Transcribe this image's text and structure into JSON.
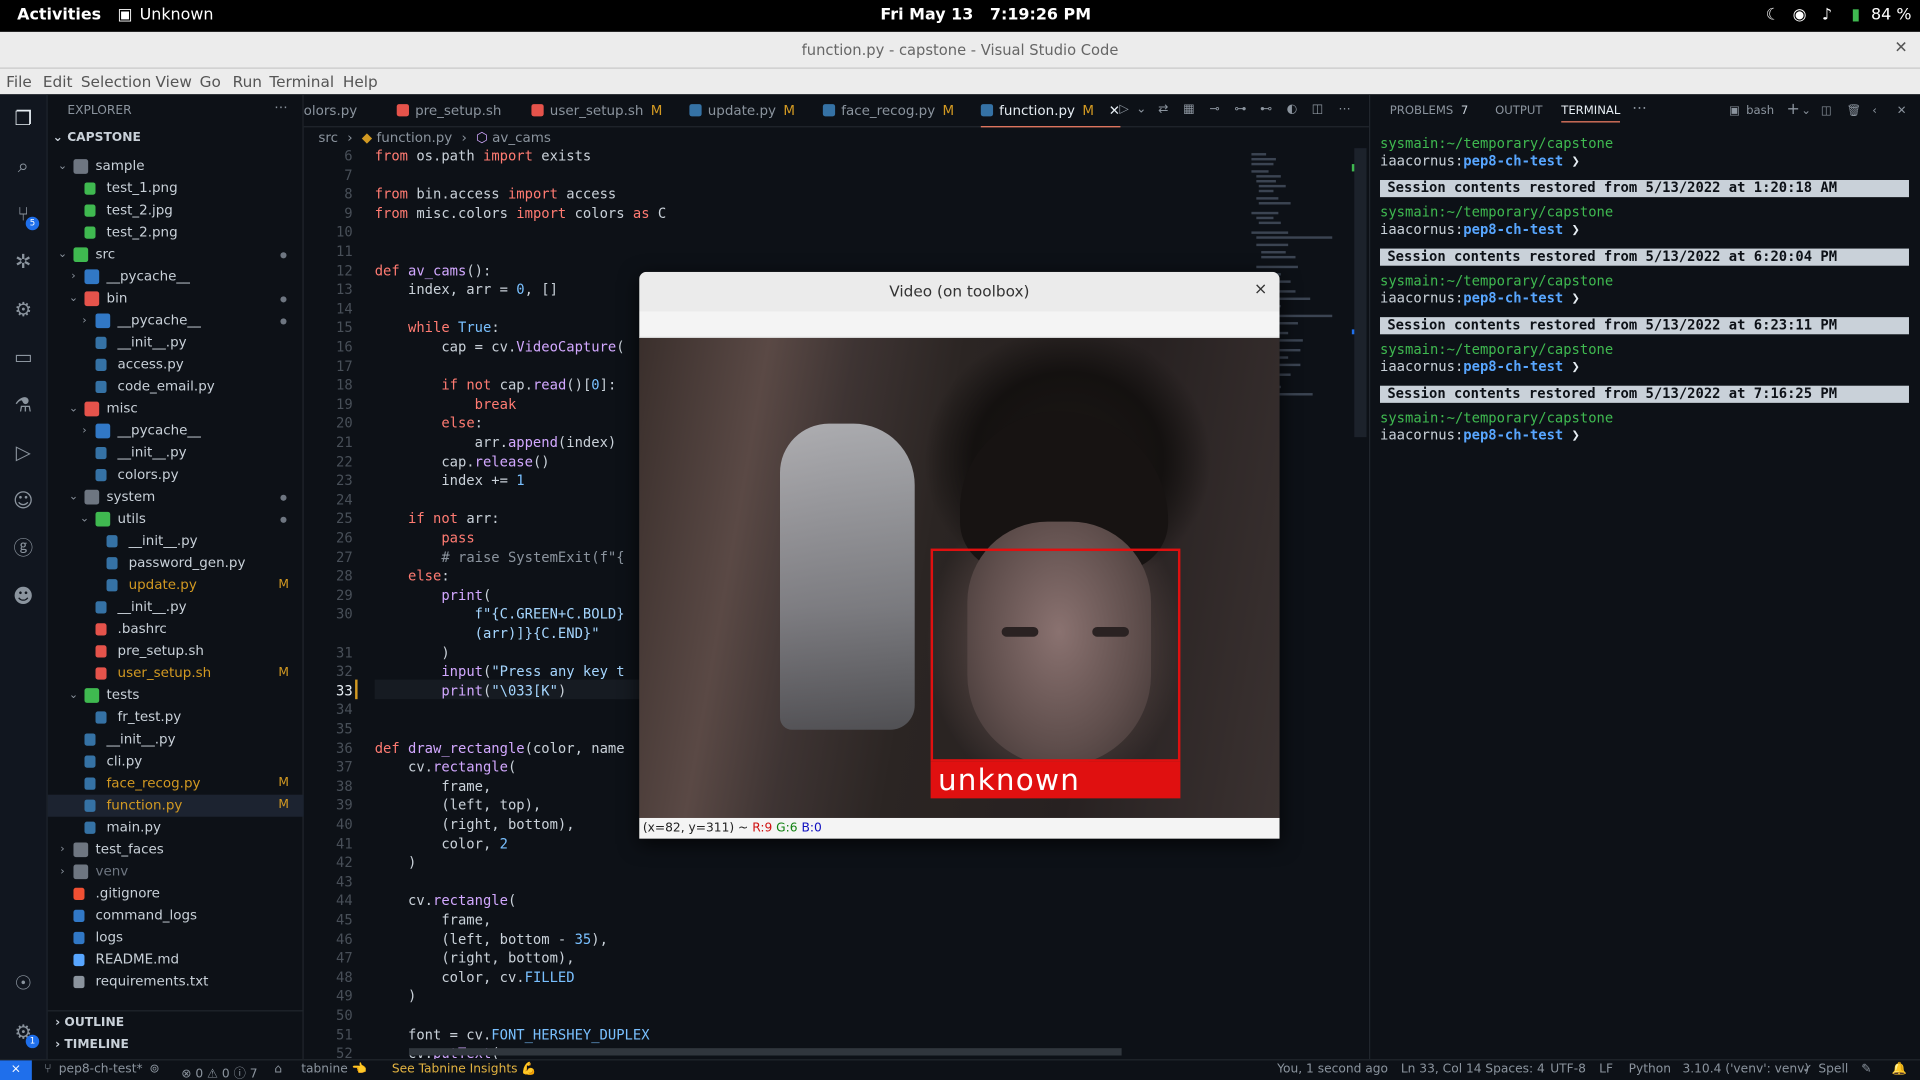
{
  "gnome": {
    "activities": "Activities",
    "app": "Unknown",
    "clock": "Fri May 13   7:19:26 PM",
    "battery": "84 %"
  },
  "window": {
    "title": "function.py - capstone - Visual Studio Code"
  },
  "menu": [
    "File",
    "Edit",
    "Selection",
    "View",
    "Go",
    "Run",
    "Terminal",
    "Help"
  ],
  "activity_badges": {
    "scm": "5",
    "settings": "1"
  },
  "explorer": {
    "header": "EXPLORER",
    "root": "CAPSTONE",
    "items": [
      {
        "l": "sample",
        "d": 1,
        "t": "dir",
        "open": true
      },
      {
        "l": "test_1.png",
        "d": 2,
        "t": "img"
      },
      {
        "l": "test_2.jpg",
        "d": 2,
        "t": "img"
      },
      {
        "l": "test_2.png",
        "d": 2,
        "t": "img"
      },
      {
        "l": "src",
        "d": 1,
        "t": "dir-src",
        "open": true,
        "dot": true
      },
      {
        "l": "__pycache__",
        "d": 2,
        "t": "dir-py",
        "open": false
      },
      {
        "l": "bin",
        "d": 2,
        "t": "dir-red",
        "open": true,
        "dot": true
      },
      {
        "l": "__pycache__",
        "d": 3,
        "t": "dir-py",
        "open": false,
        "dot": true
      },
      {
        "l": "__init__.py",
        "d": 3,
        "t": "py"
      },
      {
        "l": "access.py",
        "d": 3,
        "t": "py"
      },
      {
        "l": "code_email.py",
        "d": 3,
        "t": "py"
      },
      {
        "l": "misc",
        "d": 2,
        "t": "dir-red",
        "open": true
      },
      {
        "l": "__pycache__",
        "d": 3,
        "t": "dir-py",
        "open": false
      },
      {
        "l": "__init__.py",
        "d": 3,
        "t": "py"
      },
      {
        "l": "colors.py",
        "d": 3,
        "t": "py"
      },
      {
        "l": "system",
        "d": 2,
        "t": "dir",
        "open": true,
        "dot": true
      },
      {
        "l": "utils",
        "d": 3,
        "t": "dir-green",
        "open": true,
        "dot": true
      },
      {
        "l": "__init__.py",
        "d": 4,
        "t": "py"
      },
      {
        "l": "password_gen.py",
        "d": 4,
        "t": "py"
      },
      {
        "l": "update.py",
        "d": 4,
        "t": "py",
        "m": "M"
      },
      {
        "l": "__init__.py",
        "d": 3,
        "t": "py"
      },
      {
        "l": ".bashrc",
        "d": 3,
        "t": "sh"
      },
      {
        "l": "pre_setup.sh",
        "d": 3,
        "t": "sh"
      },
      {
        "l": "user_setup.sh",
        "d": 3,
        "t": "sh",
        "m": "M"
      },
      {
        "l": "tests",
        "d": 2,
        "t": "dir-green",
        "open": true
      },
      {
        "l": "fr_test.py",
        "d": 3,
        "t": "py"
      },
      {
        "l": "__init__.py",
        "d": 2,
        "t": "py"
      },
      {
        "l": "cli.py",
        "d": 2,
        "t": "py"
      },
      {
        "l": "face_recog.py",
        "d": 2,
        "t": "py",
        "m": "M"
      },
      {
        "l": "function.py",
        "d": 2,
        "t": "py",
        "m": "M",
        "sel": true
      },
      {
        "l": "main.py",
        "d": 2,
        "t": "py"
      },
      {
        "l": "test_faces",
        "d": 1,
        "t": "dir",
        "open": false
      },
      {
        "l": "venv",
        "d": 1,
        "t": "dir",
        "open": false,
        "dim": true
      },
      {
        "l": ".gitignore",
        "d": 1,
        "t": "git"
      },
      {
        "l": "command_logs",
        "d": 1,
        "t": "file"
      },
      {
        "l": "logs",
        "d": 1,
        "t": "file"
      },
      {
        "l": "README.md",
        "d": 1,
        "t": "info"
      },
      {
        "l": "requirements.txt",
        "d": 1,
        "t": "txt"
      }
    ],
    "outline": "OUTLINE",
    "timeline": "TIMELINE"
  },
  "tabs": [
    {
      "l": "olors.py",
      "m": "",
      "t": "none"
    },
    {
      "l": "pre_setup.sh",
      "m": "",
      "t": "sh"
    },
    {
      "l": "user_setup.sh",
      "m": "M",
      "t": "sh"
    },
    {
      "l": "update.py",
      "m": "M",
      "t": "py"
    },
    {
      "l": "face_recog.py",
      "m": "M",
      "t": "py"
    },
    {
      "l": "function.py",
      "m": "M",
      "t": "py",
      "active": true
    }
  ],
  "breadcrumb": [
    "src",
    "function.py",
    "av_cams"
  ],
  "code": [
    {
      "n": "6",
      "h": "<span class=\"kw\">from</span> os.path <span class=\"kw\">import</span> exists"
    },
    {
      "n": "7",
      "h": ""
    },
    {
      "n": "8",
      "h": "<span class=\"kw\">from</span> bin.access <span class=\"kw\">import</span> access"
    },
    {
      "n": "9",
      "h": "<span class=\"kw\">from</span> misc.colors <span class=\"kw\">import</span> colors <span class=\"kw\">as</span> C"
    },
    {
      "n": "10",
      "h": ""
    },
    {
      "n": "11",
      "h": ""
    },
    {
      "n": "12",
      "h": "<span class=\"kw\">def</span> <span class=\"fn\">av_cams</span>():"
    },
    {
      "n": "13",
      "h": "    index, arr = <span class=\"nu\">0</span>, []"
    },
    {
      "n": "14",
      "h": ""
    },
    {
      "n": "15",
      "h": "    <span class=\"kw\">while</span> <span class=\"nu\">True</span>:"
    },
    {
      "n": "16",
      "h": "        cap = cv.<span class=\"fn\">VideoCapture</span>("
    },
    {
      "n": "17",
      "h": ""
    },
    {
      "n": "18",
      "h": "        <span class=\"kw\">if not</span> cap.<span class=\"fn\">read</span>()[<span class=\"nu\">0</span>]:"
    },
    {
      "n": "19",
      "h": "            <span class=\"kw\">break</span>"
    },
    {
      "n": "20",
      "h": "        <span class=\"kw\">else</span>:"
    },
    {
      "n": "21",
      "h": "            arr.<span class=\"fn\">append</span>(index)"
    },
    {
      "n": "22",
      "h": "        cap.<span class=\"fn\">release</span>()"
    },
    {
      "n": "23",
      "h": "        index += <span class=\"nu\">1</span>"
    },
    {
      "n": "24",
      "h": ""
    },
    {
      "n": "25",
      "h": "    <span class=\"kw\">if not</span> arr:"
    },
    {
      "n": "26",
      "h": "        <span class=\"kw\">pass</span>"
    },
    {
      "n": "27",
      "h": "        <span class=\"cm\"># raise SystemExit(f\"{</span>"
    },
    {
      "n": "28",
      "h": "    <span class=\"kw\">else</span>:"
    },
    {
      "n": "29",
      "h": "        <span class=\"fn\">print</span>("
    },
    {
      "n": "30",
      "h": "            <span class=\"st\">f\"{C.GREEN+C.BOLD}</span>"
    },
    {
      "n": "",
      "h": "            <span class=\"st\">(arr)]}{C.END}\"</span>"
    },
    {
      "n": "31",
      "h": "        )"
    },
    {
      "n": "32",
      "h": "        <span class=\"fn\">input</span>(<span class=\"st\">\"Press any key t</span>"
    },
    {
      "n": "33",
      "h": "        <span class=\"fn\">print</span>(<span class=\"st\">\"\\033[K\"</span>)"
    },
    {
      "n": "34",
      "h": ""
    },
    {
      "n": "35",
      "h": ""
    },
    {
      "n": "36",
      "h": "<span class=\"kw\">def</span> <span class=\"fn\">draw_rectangle</span>(color, name"
    },
    {
      "n": "37",
      "h": "    cv.<span class=\"fn\">rectangle</span>("
    },
    {
      "n": "38",
      "h": "        frame,"
    },
    {
      "n": "39",
      "h": "        (left, top),"
    },
    {
      "n": "40",
      "h": "        (right, bottom),"
    },
    {
      "n": "41",
      "h": "        color, <span class=\"nu\">2</span>"
    },
    {
      "n": "42",
      "h": "    )"
    },
    {
      "n": "43",
      "h": ""
    },
    {
      "n": "44",
      "h": "    cv.<span class=\"fn\">rectangle</span>("
    },
    {
      "n": "45",
      "h": "        frame,"
    },
    {
      "n": "46",
      "h": "        (left, bottom - <span class=\"nu\">35</span>),"
    },
    {
      "n": "47",
      "h": "        (right, bottom),"
    },
    {
      "n": "48",
      "h": "        color, cv.<span class=\"nu\">FILLED</span>"
    },
    {
      "n": "49",
      "h": "    )"
    },
    {
      "n": "50",
      "h": ""
    },
    {
      "n": "51",
      "h": "    font = cv.<span class=\"nu\">FONT_HERSHEY_DUPLEX</span>"
    },
    {
      "n": "52",
      "h": "    cv.<span class=\"fn\">putText</span>("
    }
  ],
  "panel": {
    "problems": "PROBLEMS",
    "problems_count": "7",
    "output": "OUTPUT",
    "terminal": "TERMINAL",
    "shell": "bash"
  },
  "terminal": [
    {
      "k": "p",
      "a": "sysmain:~/temporary/capstone"
    },
    {
      "k": "u",
      "a": "iaacornus:",
      "b": "pep8-ch-test"
    },
    {
      "k": "s",
      "a": "Session contents restored from 5/13/2022 at 1:20:18 AM"
    },
    {
      "k": "p",
      "a": "sysmain:~/temporary/capstone"
    },
    {
      "k": "u",
      "a": "iaacornus:",
      "b": "pep8-ch-test"
    },
    {
      "k": "s",
      "a": "Session contents restored from 5/13/2022 at 6:20:04 PM"
    },
    {
      "k": "p",
      "a": "sysmain:~/temporary/capstone"
    },
    {
      "k": "u",
      "a": "iaacornus:",
      "b": "pep8-ch-test"
    },
    {
      "k": "s",
      "a": "Session contents restored from 5/13/2022 at 6:23:11 PM"
    },
    {
      "k": "p",
      "a": "sysmain:~/temporary/capstone"
    },
    {
      "k": "u",
      "a": "iaacornus:",
      "b": "pep8-ch-test"
    },
    {
      "k": "s",
      "a": "Session contents restored from 5/13/2022 at 7:16:25 PM"
    },
    {
      "k": "p",
      "a": "sysmain:~/temporary/capstone"
    },
    {
      "k": "u",
      "a": "iaacornus:",
      "b": "pep8-ch-test"
    }
  ],
  "video": {
    "title": "Video (on toolbox)",
    "close": "×",
    "face_label": "unknown",
    "status_coords": "(x=82, y=311) ~ ",
    "r": "R:9",
    "g": "G:6",
    "b": "B:0"
  },
  "status": {
    "branch": "pep8-ch-test*",
    "problems": "⊗ 0 ⚠ 0 ⓘ 7",
    "tabnine": "tabnine 👈",
    "insights": "See Tabnine Insights 💪",
    "blame": "You, 1 second ago",
    "pos": "Ln 33, Col 14",
    "spaces": "Spaces: 4",
    "enc": "UTF-8",
    "eol": "LF",
    "lang": "Python",
    "interp": "3.10.4 ('venv': venv)",
    "spell": "Spell"
  },
  "colors": {
    "accent": "#1f6feb",
    "face_box": "#e01010",
    "modified": "#d29922",
    "prompt": "#3fb950",
    "branch": "#58a6ff"
  }
}
